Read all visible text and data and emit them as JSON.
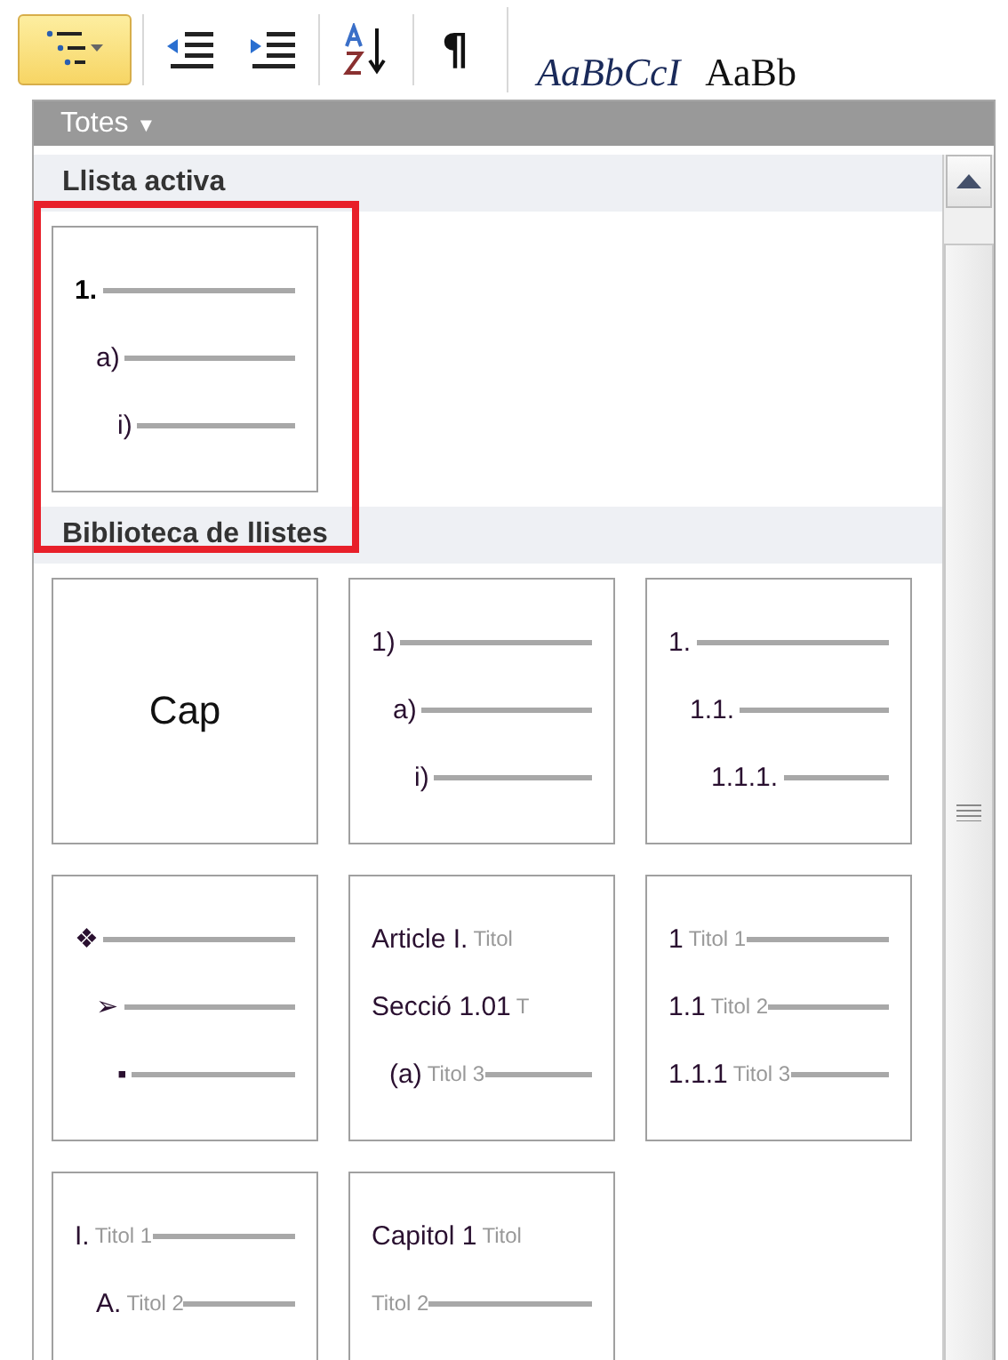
{
  "toolbar": {
    "buttons": [
      {
        "kind": "multilevel-list",
        "selected": true
      },
      {
        "kind": "decrease-indent",
        "selected": false
      },
      {
        "kind": "increase-indent",
        "selected": false
      },
      {
        "kind": "sort",
        "selected": false
      },
      {
        "kind": "pilcrow",
        "label": "¶",
        "selected": false
      }
    ],
    "style_previews": [
      "AaBbCcI",
      "AaBb"
    ]
  },
  "panel": {
    "filter": {
      "label": "Totes",
      "caret": "▼"
    },
    "highlight_active_list": true,
    "sections": [
      {
        "title": "Llista activa",
        "tiles": [
          {
            "kind": "outline",
            "levels": [
              {
                "number": "1.",
                "bold": true,
                "line": true
              },
              {
                "number": "a)",
                "bold": false,
                "line": true
              },
              {
                "number": "i)",
                "bold": false,
                "line": true
              }
            ]
          }
        ]
      },
      {
        "title": "Biblioteca de llistes",
        "tiles": [
          {
            "kind": "none",
            "label": "Cap"
          },
          {
            "kind": "outline",
            "levels": [
              {
                "number": "1)",
                "bold": false,
                "line": true
              },
              {
                "number": "a)",
                "bold": false,
                "line": true
              },
              {
                "number": "i)",
                "bold": false,
                "line": true
              }
            ]
          },
          {
            "kind": "outline",
            "levels": [
              {
                "number": "1.",
                "bold": false,
                "line": true
              },
              {
                "number": "1.1.",
                "bold": false,
                "line": true
              },
              {
                "number": "1.1.1.",
                "bold": false,
                "line": true
              }
            ]
          },
          {
            "kind": "outline",
            "levels": [
              {
                "number": "❖",
                "bold": false,
                "line": true
              },
              {
                "number": "➢",
                "bold": false,
                "line": true
              },
              {
                "number": "▪",
                "bold": false,
                "line": true
              }
            ]
          },
          {
            "kind": "headings",
            "levels": [
              {
                "number": "Article I.",
                "heading": "Titol",
                "bold": false,
                "line": false
              },
              {
                "number": "Secció 1.01",
                "heading": "T",
                "bold": false,
                "line": false
              },
              {
                "number": "(a)",
                "heading": "Titol 3",
                "bold": false,
                "line": true
              }
            ]
          },
          {
            "kind": "flat",
            "levels": [
              {
                "number": "1",
                "heading": "Titol 1",
                "bold": false,
                "line": true
              },
              {
                "number": "1.1",
                "heading": "Titol 2",
                "bold": false,
                "line": true
              },
              {
                "number": "1.1.1",
                "heading": "Titol 3",
                "bold": false,
                "line": true
              }
            ]
          },
          {
            "kind": "outline",
            "levels": [
              {
                "number": "I.",
                "heading": "Titol 1",
                "bold": false,
                "line": true
              },
              {
                "number": "A.",
                "heading": "Titol 2",
                "bold": false,
                "line": true
              }
            ]
          },
          {
            "kind": "flat",
            "levels": [
              {
                "number": "Capitol 1",
                "heading": "Titol",
                "bold": false,
                "line": false
              },
              {
                "heading": "Titol 2",
                "line": true
              }
            ]
          }
        ]
      }
    ]
  }
}
